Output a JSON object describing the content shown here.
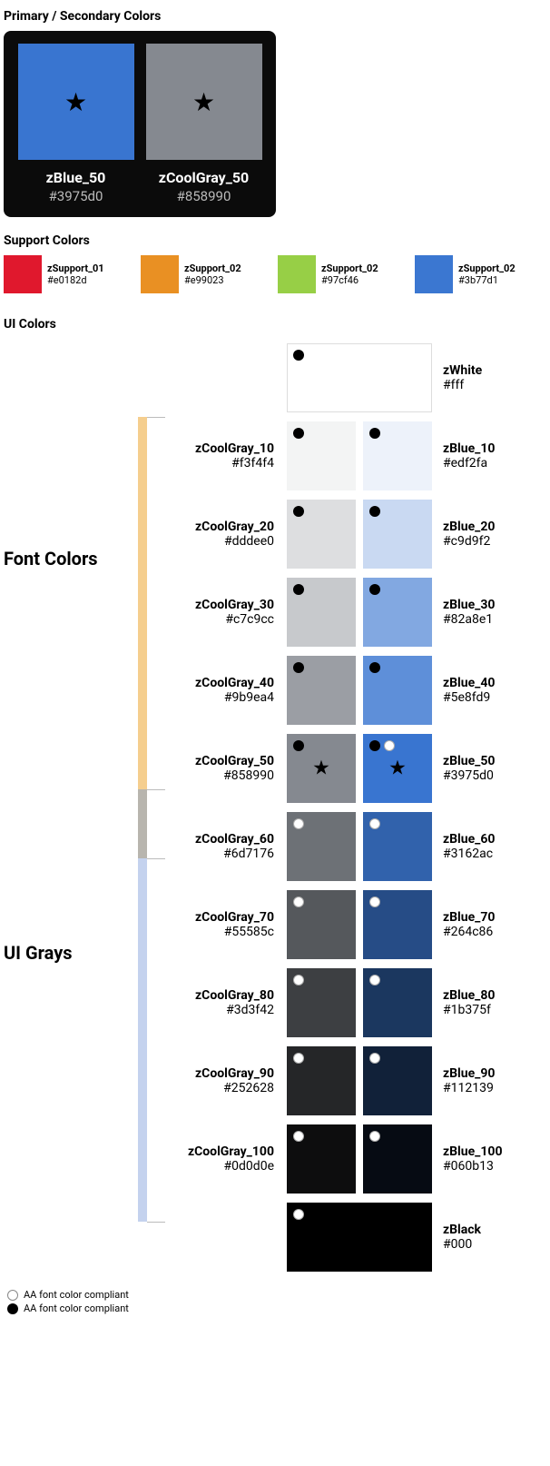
{
  "sections": {
    "primary_title": "Primary / Secondary Colors",
    "support_title": "Support Colors",
    "ui_title": "UI Colors"
  },
  "primary": [
    {
      "name": "zBlue_50",
      "hex": "#3975d0",
      "color": "#3975d0"
    },
    {
      "name": "zCoolGray_50",
      "hex": "#858990",
      "color": "#858990"
    }
  ],
  "support": [
    {
      "name": "zSupport_01",
      "hex": "#e0182d",
      "color": "#e0182d"
    },
    {
      "name": "zSupport_02",
      "hex": "#e99023",
      "color": "#e99023"
    },
    {
      "name": "zSupport_02",
      "hex": "#97cf46",
      "color": "#97cf46"
    },
    {
      "name": "zSupport_02",
      "hex": "#3b77d1",
      "color": "#3b77d1"
    }
  ],
  "ui_rows": [
    {
      "left": null,
      "gray": null,
      "blue": null,
      "white": {
        "name": "zWhite",
        "hex": "#fff",
        "color": "#ffffff",
        "dots": [
          "black"
        ],
        "bordered": true
      }
    },
    {
      "left": {
        "name": "zCoolGray_10",
        "hex": "#f3f4f4"
      },
      "gray": {
        "color": "#f3f4f4",
        "dots": [
          "black"
        ]
      },
      "blue": {
        "color": "#edf2fa",
        "dots": [
          "black"
        ]
      },
      "right": {
        "name": "zBlue_10",
        "hex": "#edf2fa"
      }
    },
    {
      "left": {
        "name": "zCoolGray_20",
        "hex": "#dddee0"
      },
      "gray": {
        "color": "#dddee0",
        "dots": [
          "black"
        ]
      },
      "blue": {
        "color": "#c9d9f2",
        "dots": [
          "black"
        ]
      },
      "right": {
        "name": "zBlue_20",
        "hex": "#c9d9f2"
      }
    },
    {
      "left": {
        "name": "zCoolGray_30",
        "hex": "#c7c9cc"
      },
      "gray": {
        "color": "#c7c9cc",
        "dots": [
          "black"
        ]
      },
      "blue": {
        "color": "#82a8e1",
        "dots": [
          "black"
        ]
      },
      "right": {
        "name": "zBlue_30",
        "hex": "#82a8e1"
      }
    },
    {
      "left": {
        "name": "zCoolGray_40",
        "hex": "#9b9ea4"
      },
      "gray": {
        "color": "#9b9ea4",
        "dots": [
          "black"
        ]
      },
      "blue": {
        "color": "#5e8fd9",
        "dots": [
          "black"
        ]
      },
      "right": {
        "name": "zBlue_40",
        "hex": "#5e8fd9"
      }
    },
    {
      "left": {
        "name": "zCoolGray_50",
        "hex": "#858990"
      },
      "gray": {
        "color": "#858990",
        "dots": [
          "black"
        ],
        "star": true
      },
      "blue": {
        "color": "#3975d0",
        "dots": [
          "black",
          "white"
        ],
        "star": true
      },
      "right": {
        "name": "zBlue_50",
        "hex": "#3975d0"
      }
    },
    {
      "left": {
        "name": "zCoolGray_60",
        "hex": "#6d7176"
      },
      "gray": {
        "color": "#6d7176",
        "dots": [
          "white"
        ]
      },
      "blue": {
        "color": "#3162ac",
        "dots": [
          "white"
        ]
      },
      "right": {
        "name": "zBlue_60",
        "hex": "#3162ac"
      }
    },
    {
      "left": {
        "name": "zCoolGray_70",
        "hex": "#55585c"
      },
      "gray": {
        "color": "#55585c",
        "dots": [
          "white"
        ]
      },
      "blue": {
        "color": "#264c86",
        "dots": [
          "white"
        ]
      },
      "right": {
        "name": "zBlue_70",
        "hex": "#264c86"
      }
    },
    {
      "left": {
        "name": "zCoolGray_80",
        "hex": "#3d3f42"
      },
      "gray": {
        "color": "#3d3f42",
        "dots": [
          "white"
        ]
      },
      "blue": {
        "color": "#1b375f",
        "dots": [
          "white"
        ]
      },
      "right": {
        "name": "zBlue_80",
        "hex": "#1b375f"
      }
    },
    {
      "left": {
        "name": "zCoolGray_90",
        "hex": "#252628"
      },
      "gray": {
        "color": "#252628",
        "dots": [
          "white"
        ]
      },
      "blue": {
        "color": "#112139",
        "dots": [
          "white"
        ]
      },
      "right": {
        "name": "zBlue_90",
        "hex": "#112139"
      }
    },
    {
      "left": {
        "name": "zCoolGray_100",
        "hex": "#0d0d0e"
      },
      "gray": {
        "color": "#0d0d0e",
        "dots": [
          "white"
        ]
      },
      "blue": {
        "color": "#060b13",
        "dots": [
          "white"
        ]
      },
      "right": {
        "name": "zBlue_100",
        "hex": "#060b13"
      }
    },
    {
      "left": null,
      "gray": null,
      "blue": null,
      "black": {
        "name": "zBlack",
        "hex": "#000",
        "color": "#000000",
        "dots": [
          "white"
        ]
      }
    }
  ],
  "ladder": {
    "font_label": "Font Colors",
    "ui_label": "UI Grays"
  },
  "legend": {
    "white": "AA font color compliant",
    "black": "AA font color compliant"
  }
}
